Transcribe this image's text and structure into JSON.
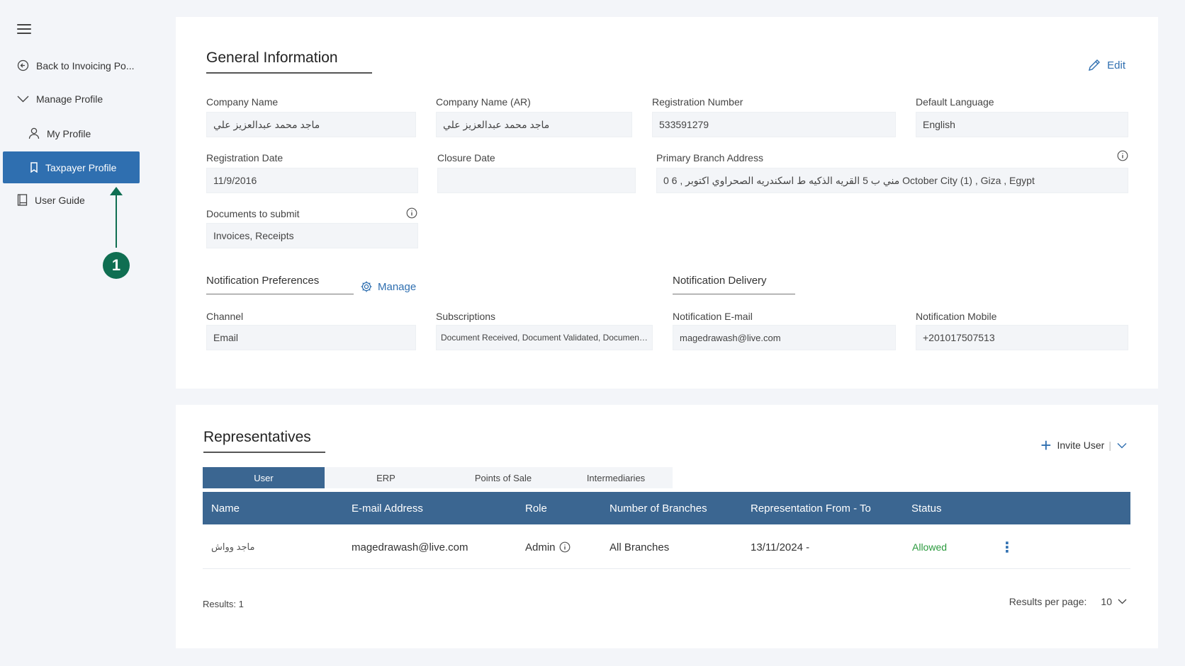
{
  "sidebar": {
    "items": [
      {
        "label": "Back to Invoicing Po..."
      },
      {
        "label": "Manage Profile"
      },
      {
        "label": "My Profile"
      },
      {
        "label": "Taxpayer Profile"
      },
      {
        "label": "User Guide"
      }
    ],
    "step_badge": "1"
  },
  "general": {
    "title": "General Information",
    "edit_label": "Edit",
    "fields": {
      "company_name": {
        "label": "Company Name",
        "value": "ماجد محمد عبدالعزيز علي"
      },
      "company_name_ar": {
        "label": "Company Name (AR)",
        "value": "ماجد محمد عبدالعزيز علي"
      },
      "registration_number": {
        "label": "Registration Number",
        "value": "533591279"
      },
      "default_language": {
        "label": "Default Language",
        "value": "English"
      },
      "registration_date": {
        "label": "Registration Date",
        "value": "11/9/2016"
      },
      "closure_date": {
        "label": "Closure Date",
        "value": ""
      },
      "primary_branch_address": {
        "label": "Primary Branch Address",
        "value": "0 6 , مني ب 5 القريه الذكيه ط اسكندريه الصحراوي اكتوبر October City (1) , Giza , Egypt"
      },
      "documents_to_submit": {
        "label": "Documents to submit",
        "value": "Invoices, Receipts"
      }
    },
    "notification_preferences": {
      "title": "Notification Preferences",
      "manage_label": "Manage",
      "channel": {
        "label": "Channel",
        "value": "Email"
      },
      "subscriptions": {
        "label": "Subscriptions",
        "value": "Document Received, Document Validated, Document C..."
      }
    },
    "notification_delivery": {
      "title": "Notification Delivery",
      "email": {
        "label": "Notification E-mail",
        "value": "magedrawash@live.com"
      },
      "mobile": {
        "label": "Notification Mobile",
        "value": "+201017507513"
      }
    }
  },
  "representatives": {
    "title": "Representatives",
    "invite_label": "Invite User",
    "invite_separator": "|",
    "tabs": [
      "User",
      "ERP",
      "Points of Sale",
      "Intermediaries"
    ],
    "columns": [
      "Name",
      "E-mail Address",
      "Role",
      "Number of Branches",
      "Representation From - To",
      "Status"
    ],
    "rows": [
      {
        "name": "ماجد وواش",
        "email": "magedrawash@live.com",
        "role": "Admin",
        "branches": "All Branches",
        "range": "13/11/2024 -",
        "status": "Allowed"
      }
    ],
    "results_label": "Results: 1",
    "per_page_label": "Results per page:",
    "per_page_value": "10"
  },
  "colors": {
    "accent": "#2f6fb0",
    "table_header": "#3b6691",
    "badge": "#0f6e52",
    "status_allowed": "#2b9a3e"
  }
}
